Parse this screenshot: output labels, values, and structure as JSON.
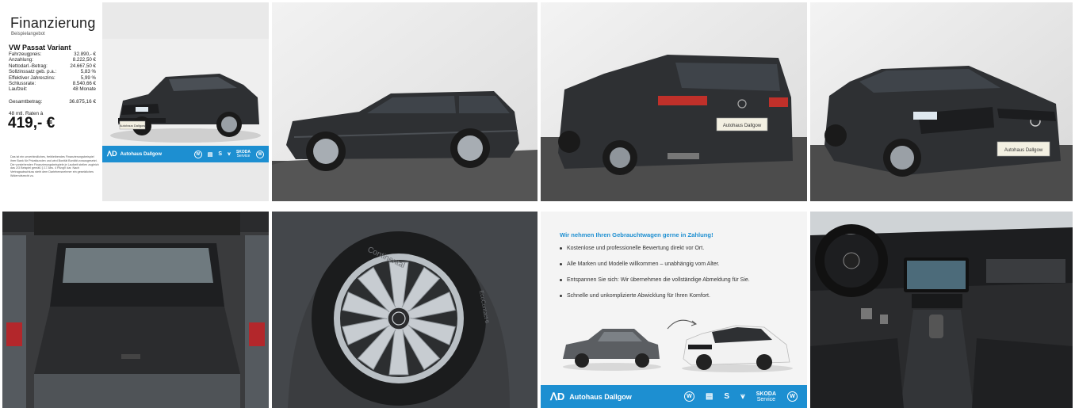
{
  "financing": {
    "title": "Finanzierung",
    "subtitle": "Beispielangebot",
    "model": "VW Passat Variant",
    "rows": [
      {
        "label": "Fahrzeugpreis:",
        "value": "32.890,- €"
      },
      {
        "label": "Anzahlung:",
        "value": "8.222,50 €"
      },
      {
        "label": "Nettodarl.-Betrag:",
        "value": "24.667,50 €"
      },
      {
        "label": "Sollzinssatz geb. p.a.:",
        "value": "5,83 %"
      },
      {
        "label": "Effektiver Jahreszins:",
        "value": "5,99 %"
      },
      {
        "label": "Schlussrate:",
        "value": "8.540,66 €"
      },
      {
        "label": "Laufzeit:",
        "value": "48 Monate"
      }
    ],
    "total_label": "Gesamtbetrag:",
    "total_value": "36.875,16 €",
    "rate_label": "48 mtl. Raten à",
    "rate_value": "419,- €",
    "disclaimer": "Das ist ein unverbindliches, freibleibendes Finanzierungsbeispiel ihrer Bank für Privatkunden und wird Bonität Bonität vorausgesetzt. Die vorstehenden Finanzierungsbeispiele je Laufzeit stellen zugleich das 2/3 Beispiel gemäß § 17 Abs. 4 PAngV dar. Nach Vertragsabschluss steht dem Darlehensnehmer ein gesetzliches Widerrufsrecht zu."
  },
  "dealer": {
    "name": "Autohaus Dallgow",
    "plate_text": "Autohaus Dallgow",
    "skoda_label": "SKODA",
    "skoda_sub": "Service"
  },
  "trade_in": {
    "heading": "Wir nehmen Ihren Gebrauchtwagen gerne in Zahlung!",
    "items": [
      "Kostenlose und professionelle Bewertung direkt vor Ort.",
      "Alle Marken und Modelle willkommen – unabhängig vom Alter.",
      "Entspannen Sie sich: Wir übernehmen die vollständige Abmeldung für Sie.",
      "Schnelle und unkomplizierte Abwicklung für Ihren Komfort."
    ]
  },
  "tire": {
    "brand": "Continental",
    "model": "EcoContact 6"
  },
  "colors": {
    "accent_blue": "#1d8fd1",
    "car_body": "#2e3033",
    "taillight": "#c0302a"
  },
  "icons": [
    "vw-icon",
    "seat-icon",
    "cupra-icon",
    "skoda-icon",
    "service-icon"
  ]
}
